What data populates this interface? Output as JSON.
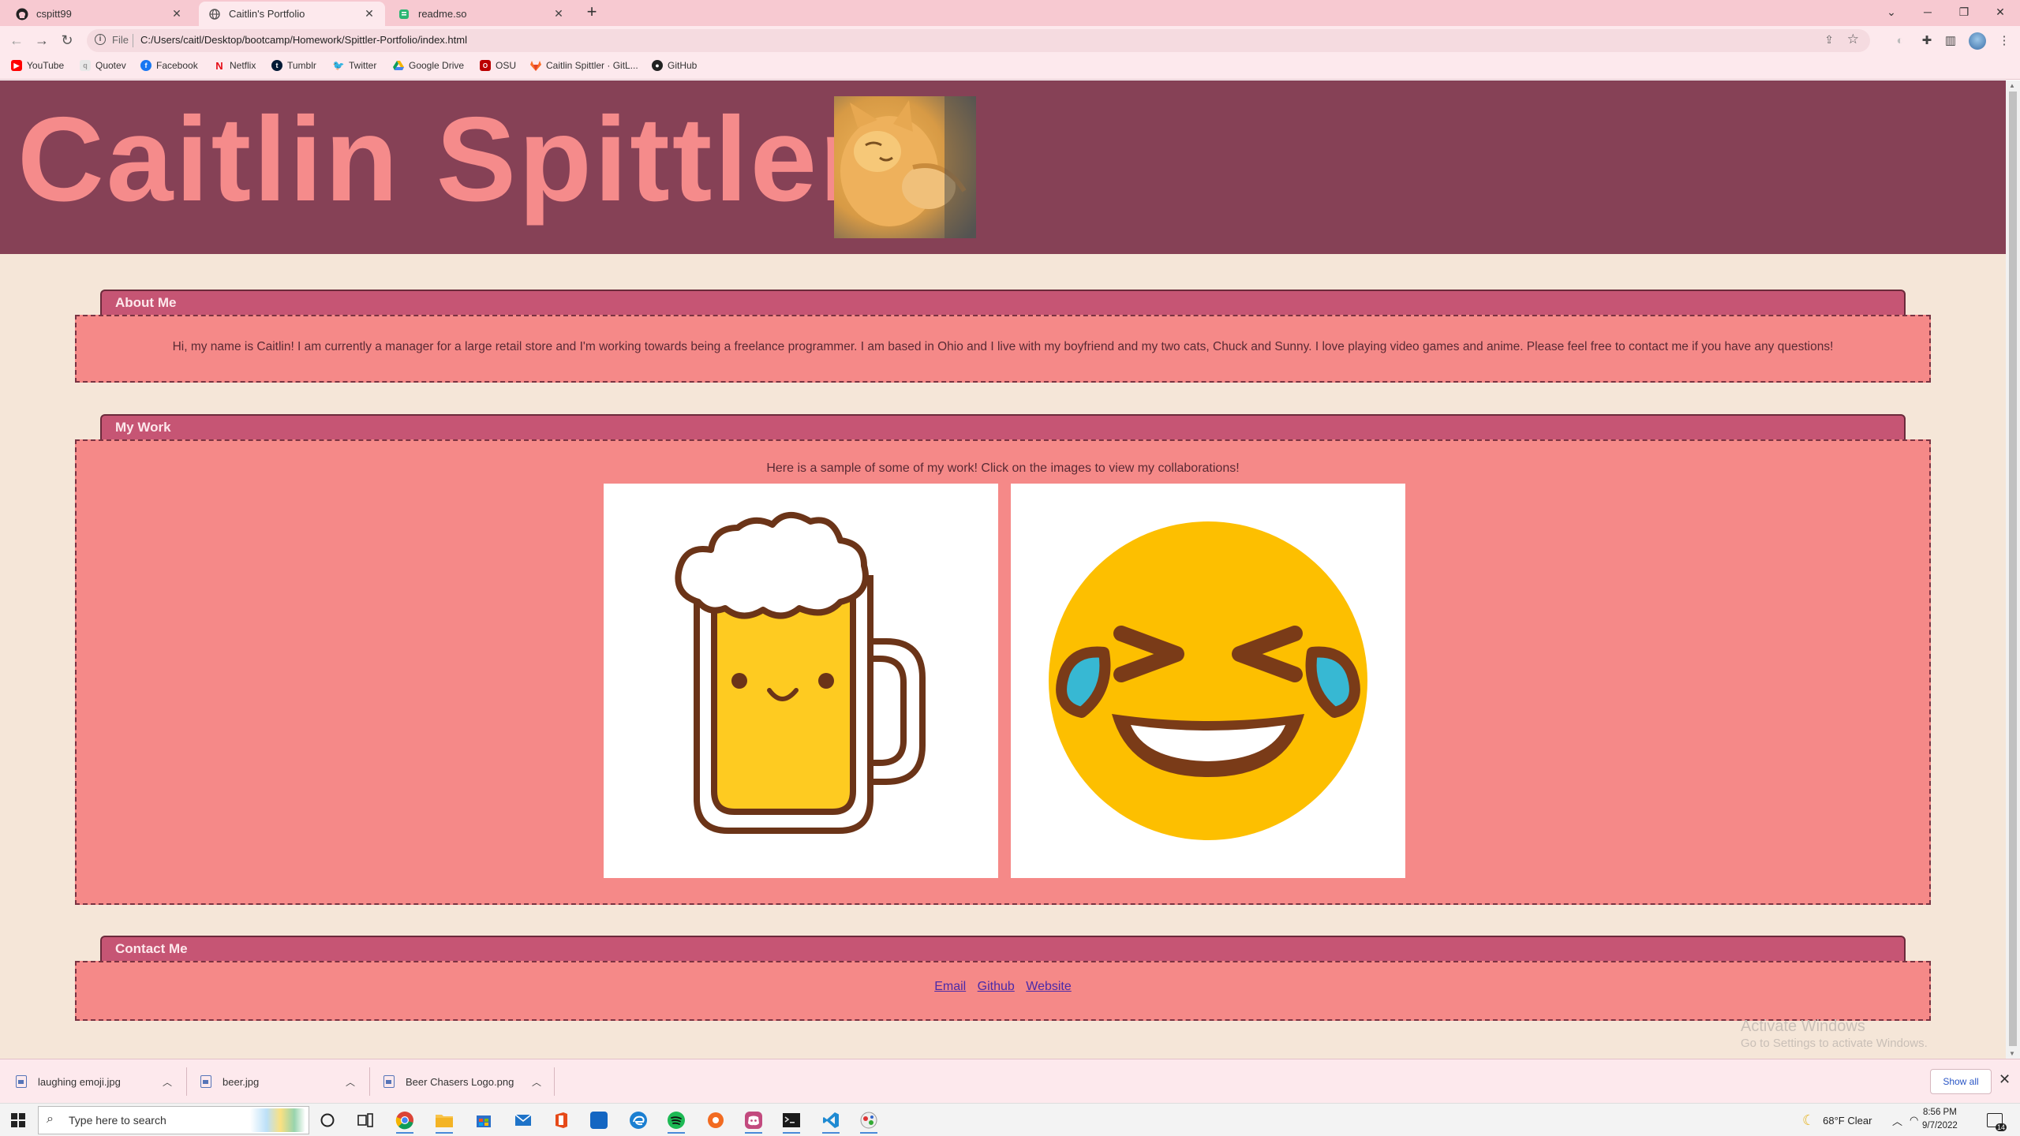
{
  "browser": {
    "tabs": [
      {
        "title": "cspitt99",
        "icon": "github-icon"
      },
      {
        "title": "Caitlin's Portfolio",
        "icon": "globe-icon"
      },
      {
        "title": "readme.so",
        "icon": "readme-icon"
      }
    ],
    "url_protocol": "File",
    "url": "C:/Users/caitl/Desktop/bootcamp/Homework/Spittler-Portfolio/index.html"
  },
  "bookmarks": [
    {
      "label": "YouTube",
      "icon": "youtube-icon",
      "color": "#ff0000"
    },
    {
      "label": "Quotev",
      "icon": "quotev-icon",
      "color": "#e8e8e8"
    },
    {
      "label": "Facebook",
      "icon": "facebook-icon",
      "color": "#1877f2"
    },
    {
      "label": "Netflix",
      "icon": "netflix-icon",
      "color": "#e50914"
    },
    {
      "label": "Tumblr",
      "icon": "tumblr-icon",
      "color": "#001935"
    },
    {
      "label": "Twitter",
      "icon": "twitter-icon",
      "color": "#1d9bf0"
    },
    {
      "label": "Google Drive",
      "icon": "google-drive-icon",
      "color": "#f4b400"
    },
    {
      "label": "OSU",
      "icon": "osu-icon",
      "color": "#bb0000"
    },
    {
      "label": "Caitlin Spittler · GitL...",
      "icon": "gitlab-icon",
      "color": "#fc6d26"
    },
    {
      "label": "GitHub",
      "icon": "github-icon",
      "color": "#222222"
    }
  ],
  "page": {
    "title": "Caitlin Spittler",
    "about": {
      "heading": "About Me",
      "text": "Hi, my name is Caitlin! I am currently a manager for a large retail store and I'm working towards being a freelance programmer. I am based in Ohio and I live with my boyfriend and my two cats, Chuck and Sunny. I love playing video games and anime. Please feel free to contact me if you have any questions!"
    },
    "work": {
      "heading": "My Work",
      "intro": "Here is a sample of some of my work! Click on the images to view my collaborations!"
    },
    "contact": {
      "heading": "Contact Me",
      "links": [
        "Email",
        "Github",
        "Website"
      ]
    }
  },
  "watermark": {
    "line1": "Activate Windows",
    "line2": "Go to Settings to activate Windows."
  },
  "downloads": {
    "items": [
      "laughing emoji.jpg",
      "beer.jpg",
      "Beer Chasers Logo.png"
    ],
    "show_all": "Show all"
  },
  "taskbar": {
    "search_placeholder": "Type here to search",
    "weather": "68°F  Clear",
    "time": "8:56 PM",
    "date": "9/7/2022",
    "notifications": "14"
  },
  "colors": {
    "header_bg": "#864156",
    "title": "#f58b8b",
    "section_head": "#c65574",
    "section_body": "#f58988",
    "page_bg": "#f5e6d8"
  }
}
